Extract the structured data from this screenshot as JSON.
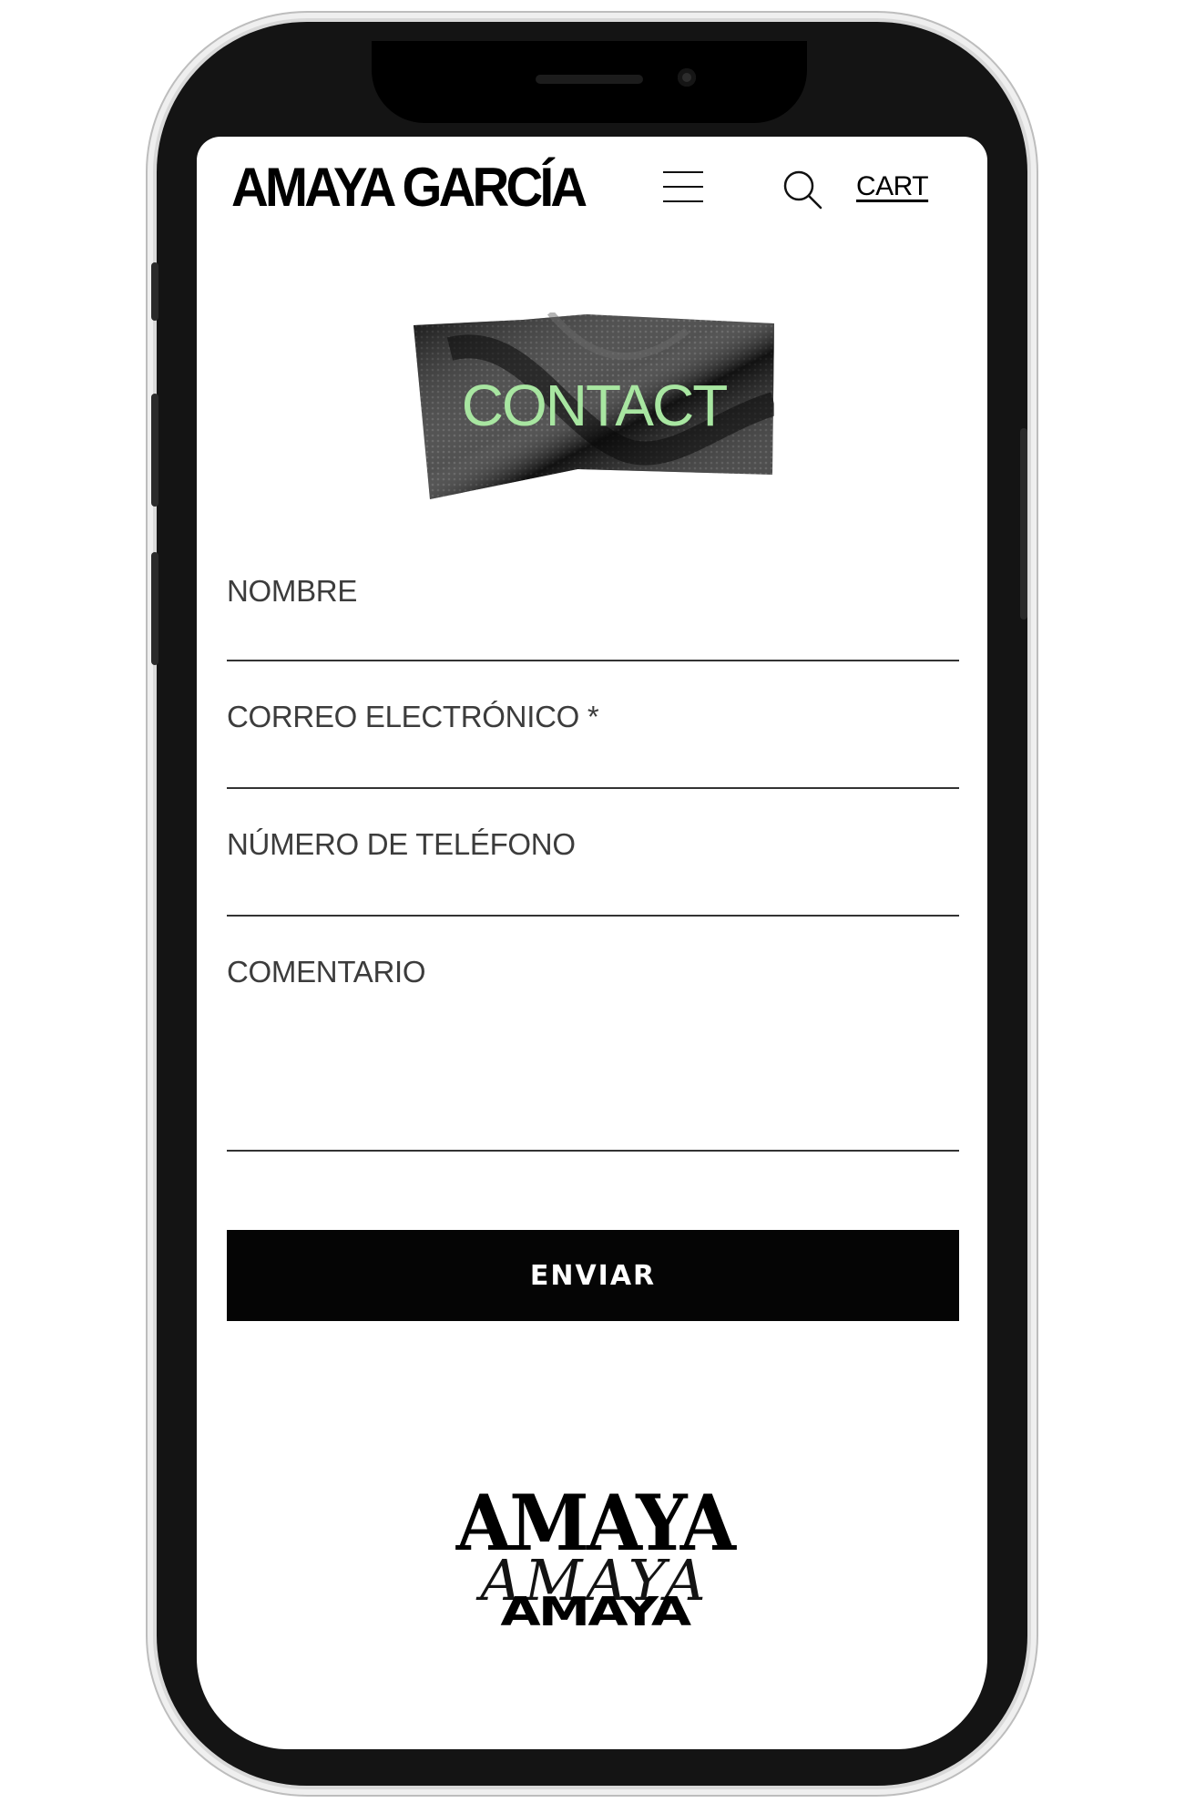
{
  "header": {
    "logo": "AMAYA GARCÍA",
    "menu_icon": "hamburger-menu-icon",
    "search_icon": "search-icon",
    "cart_label": "CART"
  },
  "hero": {
    "title": "CONTACT",
    "title_color": "#a8e6a1"
  },
  "form": {
    "fields": [
      {
        "label": "NOMBRE",
        "value": ""
      },
      {
        "label": "CORREO ELECTRÓNICO *",
        "value": ""
      },
      {
        "label": "NÚMERO DE TELÉFONO",
        "value": ""
      },
      {
        "label": "COMENTARIO",
        "value": ""
      }
    ],
    "submit_label": "ENVIAR"
  },
  "footer": {
    "logo_lines": [
      "AMAYA",
      "AMAYA",
      "AMAYA"
    ]
  }
}
